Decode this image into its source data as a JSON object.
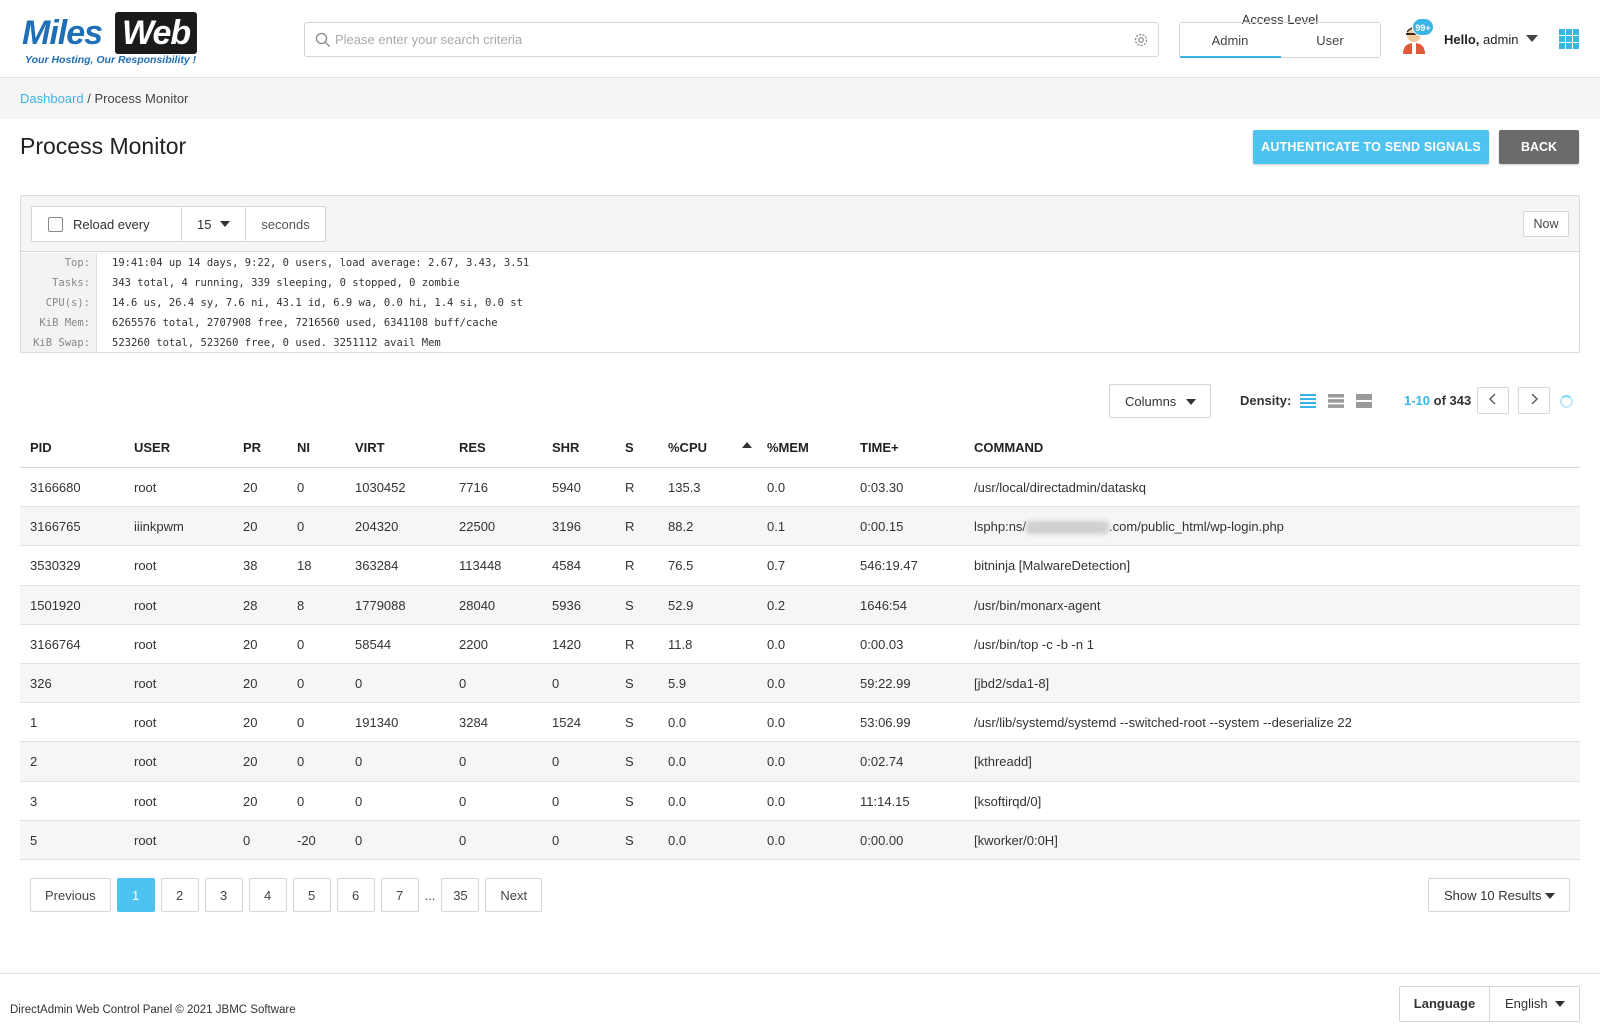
{
  "header": {
    "logo_miles": "Miles",
    "logo_web": "Web",
    "logo_tagline": "Your Hosting, Our Responsibility !",
    "search_placeholder": "Please enter your search criteria",
    "access_level_title": "Access Level",
    "access_admin": "Admin",
    "access_user": "User",
    "notification_badge": "99+",
    "hello_prefix": "Hello,",
    "hello_user": "admin"
  },
  "breadcrumb": {
    "dashboard": "Dashboard",
    "separator": " / ",
    "current": "Process Monitor"
  },
  "page": {
    "title": "Process Monitor",
    "auth_button": "AUTHENTICATE TO SEND SIGNALS",
    "back_button": "BACK"
  },
  "reload": {
    "label": "Reload every",
    "interval": "15",
    "unit": "seconds",
    "now_button": "Now"
  },
  "stats": [
    {
      "key": "Top:",
      "value": "19:41:04 up 14 days, 9:22, 0 users, load average: 2.67, 3.43, 3.51"
    },
    {
      "key": "Tasks:",
      "value": "343 total, 4 running, 339 sleeping, 0 stopped, 0 zombie"
    },
    {
      "key": "CPU(s):",
      "value": "14.6 us, 26.4 sy, 7.6 ni, 43.1 id, 6.9 wa, 0.0 hi, 1.4 si, 0.0 st"
    },
    {
      "key": "KiB Mem:",
      "value": "6265576 total, 2707908 free, 7216560 used, 6341108 buff/cache"
    },
    {
      "key": "KiB Swap:",
      "value": "523260 total, 523260 free, 0 used. 3251112 avail Mem"
    }
  ],
  "toolbar": {
    "columns_button": "Columns",
    "density_label": "Density:",
    "range_highlight": "1-10",
    "range_rest": " of 343"
  },
  "table": {
    "headers": [
      "PID",
      "USER",
      "PR",
      "NI",
      "VIRT",
      "RES",
      "SHR",
      "S",
      "%CPU",
      "%MEM",
      "TIME+",
      "COMMAND"
    ],
    "rows": [
      [
        "3166680",
        "root",
        "20",
        "0",
        "1030452",
        "7716",
        "5940",
        "R",
        "135.3",
        "0.0",
        "0:03.30",
        "/usr/local/directadmin/dataskq"
      ],
      [
        "3166765",
        "iiinkpwm",
        "20",
        "0",
        "204320",
        "22500",
        "3196",
        "R",
        "88.2",
        "0.1",
        "0:00.15",
        "lsphp:ns/"
      ],
      [
        "3530329",
        "root",
        "38",
        "18",
        "363284",
        "113448",
        "4584",
        "R",
        "76.5",
        "0.7",
        "546:19.47",
        "bitninja [MalwareDetection]"
      ],
      [
        "1501920",
        "root",
        "28",
        "8",
        "1779088",
        "28040",
        "5936",
        "S",
        "52.9",
        "0.2",
        "1646:54",
        "/usr/bin/monarx-agent"
      ],
      [
        "3166764",
        "root",
        "20",
        "0",
        "58544",
        "2200",
        "1420",
        "R",
        "11.8",
        "0.0",
        "0:00.03",
        "/usr/bin/top -c -b -n 1"
      ],
      [
        "326",
        "root",
        "20",
        "0",
        "0",
        "0",
        "0",
        "S",
        "5.9",
        "0.0",
        "59:22.99",
        "[jbd2/sda1-8]"
      ],
      [
        "1",
        "root",
        "20",
        "0",
        "191340",
        "3284",
        "1524",
        "S",
        "0.0",
        "0.0",
        "53:06.99",
        "/usr/lib/systemd/systemd --switched-root --system --deserialize 22"
      ],
      [
        "2",
        "root",
        "20",
        "0",
        "0",
        "0",
        "0",
        "S",
        "0.0",
        "0.0",
        "0:02.74",
        "[kthreadd]"
      ],
      [
        "3",
        "root",
        "20",
        "0",
        "0",
        "0",
        "0",
        "S",
        "0.0",
        "0.0",
        "11:14.15",
        "[ksoftirqd/0]"
      ],
      [
        "5",
        "root",
        "0",
        "-20",
        "0",
        "0",
        "0",
        "S",
        "0.0",
        "0.0",
        "0:00.00",
        "[kworker/0:0H]"
      ]
    ],
    "row2_command_suffix": ".com/public_html/wp-login.php"
  },
  "pagination": {
    "previous": "Previous",
    "pages": [
      "1",
      "2",
      "3",
      "4",
      "5",
      "6",
      "7"
    ],
    "ellipsis": "...",
    "last_page": "35",
    "next": "Next",
    "show_results": "Show 10 Results"
  },
  "footer": {
    "copyright": "DirectAdmin Web Control Panel © 2021 JBMC Software",
    "language_label": "Language",
    "language_value": "English"
  },
  "colors": {
    "accent": "#3ab5e8",
    "brand_blue": "#1f6fb8",
    "back_button": "#6b6b6b"
  }
}
